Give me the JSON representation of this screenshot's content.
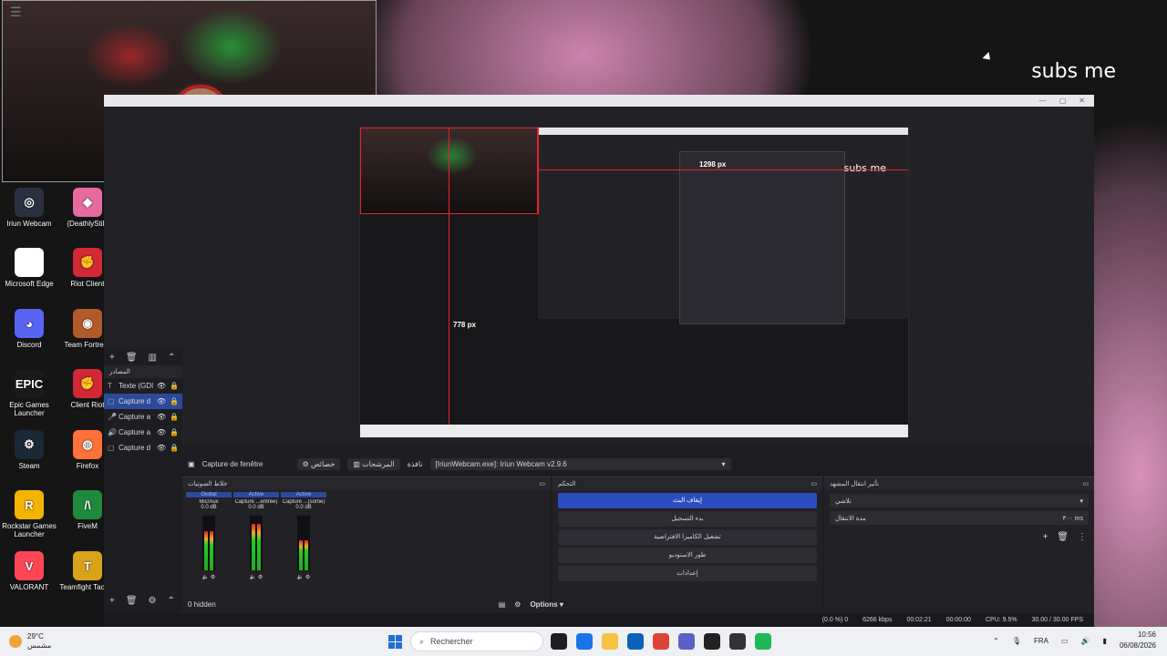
{
  "overlay": {
    "subs_text": "subs me"
  },
  "desktop_icons": [
    {
      "label": "Iriun Webcam",
      "color": "#2a3040",
      "glyph": "◎"
    },
    {
      "label": "Microsoft Edge",
      "color": "#ffffff",
      "glyph": ""
    },
    {
      "label": "Discord",
      "color": "#5865f2",
      "glyph": "◕"
    },
    {
      "label": "Epic Games Launcher",
      "color": "#1a1a1a",
      "glyph": "EPIC"
    },
    {
      "label": "Steam",
      "color": "#1b2838",
      "glyph": "⚙"
    },
    {
      "label": "Rockstar Games Launcher",
      "color": "#f3b400",
      "glyph": "R"
    },
    {
      "label": "VALORANT",
      "color": "#ff4655",
      "glyph": "V"
    },
    {
      "label": "(DeathlyStill)",
      "color": "#e66aa0",
      "glyph": "◆"
    },
    {
      "label": "Riot Client",
      "color": "#d32936",
      "glyph": "✊"
    },
    {
      "label": "Team Fortress",
      "color": "#b35a2a",
      "glyph": "◉"
    },
    {
      "label": "Client Riot",
      "color": "#d32936",
      "glyph": "✊"
    },
    {
      "label": "Firefox",
      "color": "#ff7139",
      "glyph": "◍"
    },
    {
      "label": "FiveM",
      "color": "#1f8a3c",
      "glyph": "/\\"
    },
    {
      "label": "Teamfight Tactics",
      "color": "#d8a21b",
      "glyph": "T"
    }
  ],
  "preview": {
    "nested_subs": "subs me",
    "px_top": "1298 px",
    "px_left": "778 px"
  },
  "sources": {
    "title": "المصادر",
    "items": [
      {
        "label": "Texte (GDI",
        "icon": "T",
        "selected": false
      },
      {
        "label": "Capture d",
        "icon": "▢",
        "selected": true
      },
      {
        "label": "Capture a",
        "icon": "🎤",
        "selected": false
      },
      {
        "label": "Capture a",
        "icon": "🔊",
        "selected": false
      },
      {
        "label": "Capture d",
        "icon": "▢",
        "selected": false
      }
    ],
    "hidden_count": "0 hidden"
  },
  "source_bar": {
    "source_name": "Capture de fenêtre",
    "properties_label": "خصائص",
    "filters_label": "المرشحات",
    "window_label": "نافذة",
    "window_value": "[IriunWebcam.exe]: Iriun Webcam v2.9.6"
  },
  "mixer": {
    "title": "خلاط الصوتيات",
    "channels": [
      {
        "tab": "Global",
        "name": "Mic/Aux",
        "db": "0.0 dB",
        "level": 0.72
      },
      {
        "tab": "Active",
        "name": "Capture ...entrée)",
        "db": "0.0 dB",
        "level": 0.85
      },
      {
        "tab": "Active",
        "name": "Capture ...(sortie)",
        "db": "0.0 dB",
        "level": 0.55
      }
    ]
  },
  "controls": {
    "title": "التحكم",
    "buttons": [
      "إيقاف البث",
      "بدء التسجيل",
      "تشغيل الكاميرا الافتراضية",
      "طور الاستوديو",
      "إعدادات"
    ]
  },
  "transitions": {
    "title": "تأثير انتقال المشهد",
    "effect": "تلاشي",
    "duration_label": "مدة الانتقال",
    "duration_value": "٣٠٠ ms"
  },
  "bottom_toolbar": {
    "options_label": "Options"
  },
  "status": {
    "dropped": "(0.0 %) 0",
    "bitrate": "6266 kbps",
    "live_time": "00:02:21",
    "rec_time": "00:00:00",
    "cpu": "CPU: 9.5%",
    "fps": "30.00 / 30.00 FPS"
  },
  "taskbar": {
    "temp": "29°C",
    "condition": "مشمس",
    "search_placeholder": "Rechercher",
    "lang": "FRA",
    "time": "10:56",
    "date": "06/08/2026",
    "apps": [
      "#1f1f1f",
      "#1a73e8",
      "#f5c242",
      "#0a62b8",
      "#db4437",
      "#5b5fc7",
      "#222222",
      "#333333",
      "#1db954"
    ]
  }
}
